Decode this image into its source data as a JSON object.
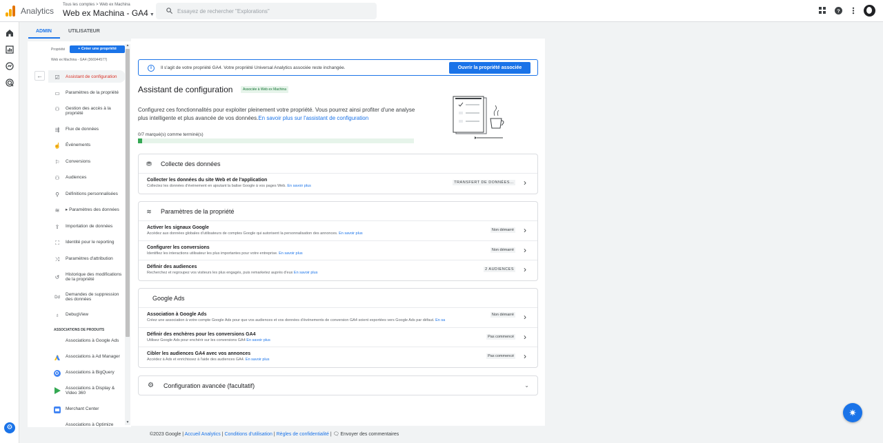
{
  "app": {
    "name": "Analytics",
    "account_crumb": "Tous les comptes > Web ex Machina",
    "property_name": "Web ex Machina - GA4",
    "search_placeholder": "Essayez de rechercher \"Explorations\""
  },
  "tabs": [
    {
      "label": "ADMIN",
      "active": true
    },
    {
      "label": "UTILISATEUR",
      "active": false
    }
  ],
  "adminnav": {
    "property_label": "Propriété",
    "create_button": "Créer une propriété",
    "property_id": "Web ex Machina - GA4 (366944577)",
    "items": [
      {
        "label": "Assistant de configuration",
        "icon": "checklist-icon",
        "active": true
      },
      {
        "label": "Paramètres de la propriété",
        "icon": "property-settings-icon",
        "active": false
      },
      {
        "label": "Gestion des accès à la propriété",
        "icon": "people-icon",
        "active": false
      },
      {
        "label": "Flux de données",
        "icon": "data-stream-icon",
        "active": false
      },
      {
        "label": "Événements",
        "icon": "events-icon",
        "active": false
      },
      {
        "label": "Conversions",
        "icon": "flag-icon",
        "active": false
      },
      {
        "label": "Audiences",
        "icon": "audiences-icon",
        "active": false
      },
      {
        "label": "Définitions personnalisées",
        "icon": "custom-definitions-icon",
        "active": false
      },
      {
        "label": "▸ Paramètres des données",
        "icon": "database-icon",
        "active": false
      },
      {
        "label": "Importation de données",
        "icon": "upload-icon",
        "active": false
      },
      {
        "label": "Identité pour le reporting",
        "icon": "identity-icon",
        "active": false
      },
      {
        "label": "Paramètres d'attribution",
        "icon": "attribution-icon",
        "active": false
      },
      {
        "label": "Historique des modifications de la propriété",
        "icon": "history-icon",
        "active": false
      },
      {
        "label": "Demandes de suppression des données",
        "icon": "delete-data-icon",
        "active": false
      },
      {
        "label": "DebugView",
        "icon": "debug-icon",
        "active": false
      }
    ],
    "section_title": "ASSOCIATIONS DE PRODUITS",
    "product_links": [
      {
        "label": "Associations à Google Ads",
        "icon": "google-ads-icon"
      },
      {
        "label": "Associations à Ad Manager",
        "icon": "ad-manager-icon"
      },
      {
        "label": "Associations à BigQuery",
        "icon": "bigquery-icon"
      },
      {
        "label": "Associations à Display & Video 360",
        "icon": "dv360-icon"
      },
      {
        "label": "Merchant Center",
        "icon": "merchant-center-icon"
      },
      {
        "label": "Associations à Optimize",
        "icon": "optimize-icon"
      }
    ]
  },
  "banner": {
    "text": "Il s'agit de votre propriété GA4. Votre propriété Universal Analytics associée reste inchangée.",
    "button": "Ouvrir la propriété associée"
  },
  "page": {
    "title": "Assistant de configuration",
    "badge": "Associée à Web ex Machina",
    "intro": "Configurez ces fonctionnalités pour exploiter pleinement votre propriété. Vous pourrez ainsi profiter d'une analyse plus intelligente et plus avancée de vos données.",
    "intro_link": "En savoir plus sur l'assistant de configuration",
    "progress_label": "0/7 marqué(s) comme terminé(s)",
    "progress_fraction": 0.015
  },
  "cards": {
    "collect": {
      "title": "Collecte des données",
      "rows": [
        {
          "title": "Collecter les données du site Web et de l'application",
          "desc": "Collectez les données d'événement en ajoutant la balise Google à vos pages Web.",
          "link": "En savoir plus",
          "status": "TRANSFERT DE DONNÉES..."
        }
      ]
    },
    "property": {
      "title": "Paramètres de la propriété",
      "rows": [
        {
          "title": "Activer les signaux Google",
          "desc": "Accédez aux données globales d'utilisateurs de comptes Google qui autorisent la personnalisation des annonces.",
          "link": "En savoir plus",
          "status": "Non démarré"
        },
        {
          "title": "Configurer les conversions",
          "desc": "Identifiez les interactions utilisateur les plus importantes pour votre entreprise.",
          "link": "En savoir plus",
          "status": "Non démarré"
        },
        {
          "title": "Définir des audiences",
          "desc": "Recherchez et regroupez vos visiteurs les plus engagés, puis remarketez auprès d'eux",
          "link": "En savoir plus",
          "status": "2 AUDIENCES"
        }
      ]
    },
    "ads": {
      "title": "Google Ads",
      "rows": [
        {
          "title": "Association à Google Ads",
          "desc": "Créez une association à votre compte Google Ads pour que vos audiences et vos données d'événements de conversion GA4 soient exportées vers Google Ads par défaut.",
          "link": "En sa",
          "status": "Non démarré"
        },
        {
          "title": "Définir des enchères pour les conversions GA4",
          "desc": "Utilisez Google Ads pour enchérir sur les conversions GA4",
          "link": "En savoir plus",
          "status": "Pas commencé"
        },
        {
          "title": "Cibler les audiences GA4 avec vos annonces",
          "desc": "Accédez à Ads et enrichissez à l'aide des audiences GA4.",
          "link": "En savoir plus",
          "status": "Pas commencé"
        }
      ]
    },
    "advanced": {
      "title": "Configuration avancée (facultatif)"
    }
  },
  "footer": {
    "copyright": "©2023 Google |",
    "home": "Accueil Analytics",
    "terms": "Conditions d'utilisation",
    "privacy": "Règles de confidentialité",
    "feedback": "Envoyer des commentaires",
    "sep": "|"
  },
  "colors": {
    "accent": "#1a73e8",
    "active_nav": "#d93025",
    "progress": "#34a853",
    "logo": [
      "#f9ab00",
      "#e37400",
      "#e8710a"
    ]
  }
}
